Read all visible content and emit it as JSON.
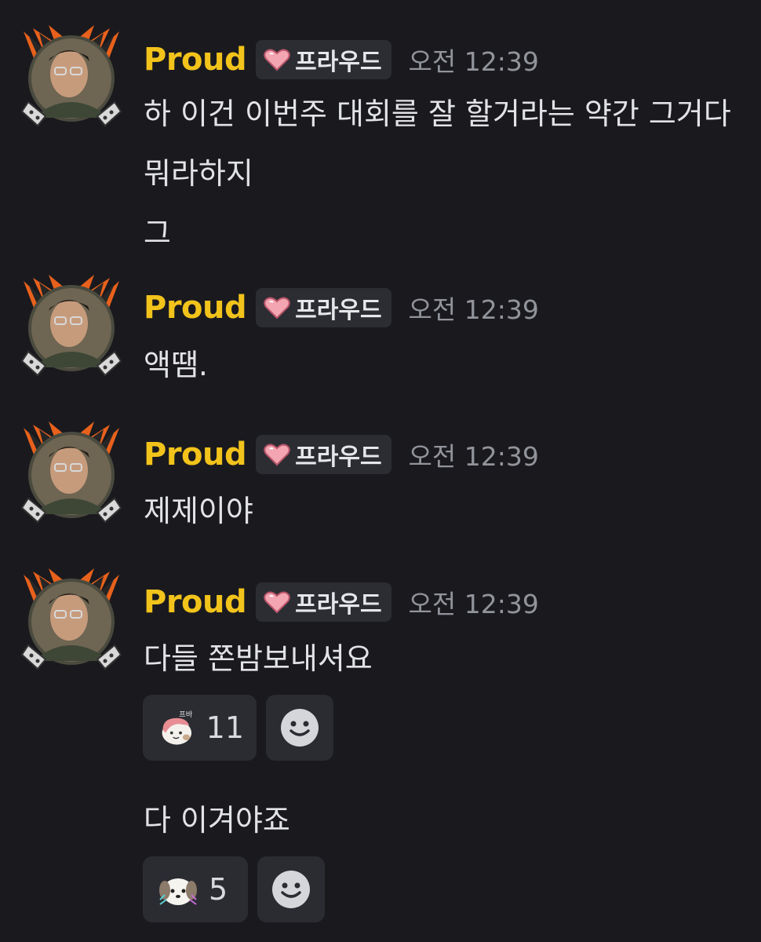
{
  "colors": {
    "background": "#1a1a1e",
    "username": "#f2c31b",
    "role_tag_bg": "#2c2d33",
    "timestamp": "#92949b",
    "text": "#e2e3e7"
  },
  "author": {
    "name": "Proud",
    "role": "프라우드",
    "role_icon": "heart-icon",
    "avatar": "avatar-with-spiky-frame"
  },
  "messages": [
    {
      "time": "오전 12:39",
      "lines": [
        "하 이건 이번주 대회를 잘 할거라는 약간 그거다",
        "뭐라하지",
        "그"
      ]
    },
    {
      "time": "오전 12:39",
      "lines": [
        "액땜."
      ]
    },
    {
      "time": "오전 12:39",
      "lines": [
        "제제이야"
      ]
    },
    {
      "time": "오전 12:39",
      "lines": [
        "다들 쫀밤보내셔요",
        "다 이겨야죠"
      ],
      "reactions": [
        [
          {
            "emoji": "custom-sticker-emoji",
            "count": "11"
          }
        ],
        [
          {
            "emoji": "custom-puppy-emoji",
            "count": "5"
          }
        ]
      ]
    }
  ],
  "add_reaction_icon": "smile-icon"
}
